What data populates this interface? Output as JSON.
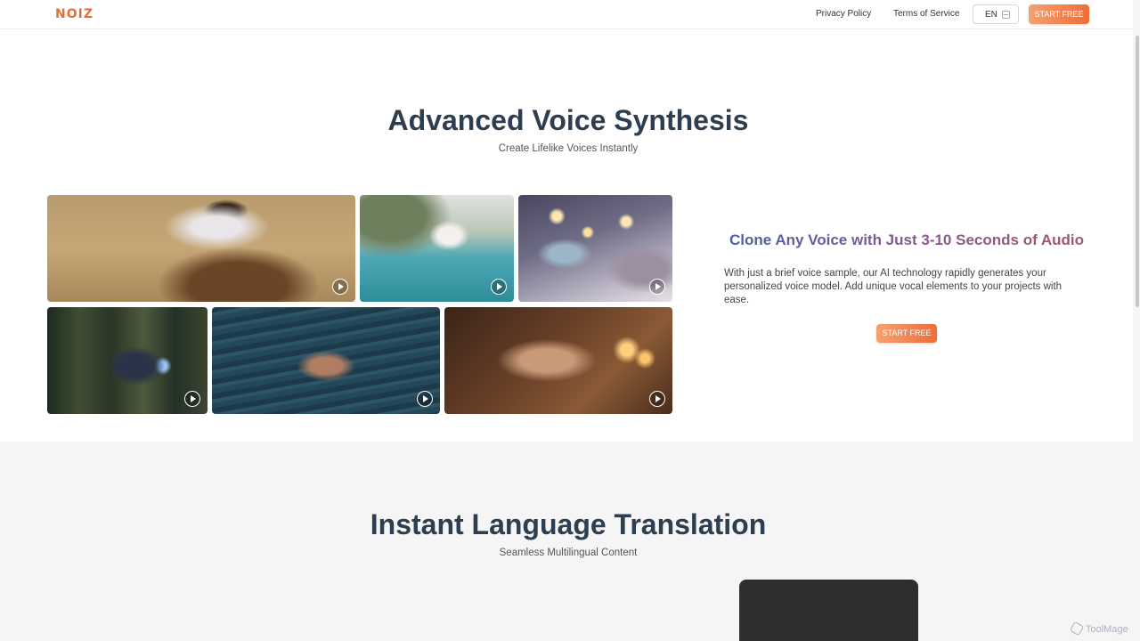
{
  "header": {
    "logo": "NOIZ",
    "nav": [
      "Privacy Policy",
      "Terms of Service"
    ],
    "language": "EN",
    "cta": "START FREE"
  },
  "voice_synthesis": {
    "title": "Advanced Voice Synthesis",
    "subtitle": "Create Lifelike Voices Instantly",
    "clone_title": "Clone Any Voice with Just 3-10 Seconds of Audio",
    "clone_desc": "With just a brief voice sample, our AI technology rapidly generates your personalized voice model. Add unique vocal elements to your projects with ease.",
    "cta": "START FREE"
  },
  "translation": {
    "title": "Instant Language Translation",
    "subtitle": "Seamless Multilingual Content"
  },
  "watermark": "ToolMage",
  "colors": {
    "accent": "#ee6d38",
    "heading": "#2c3e50",
    "section_bg": "#f5f5f5"
  }
}
